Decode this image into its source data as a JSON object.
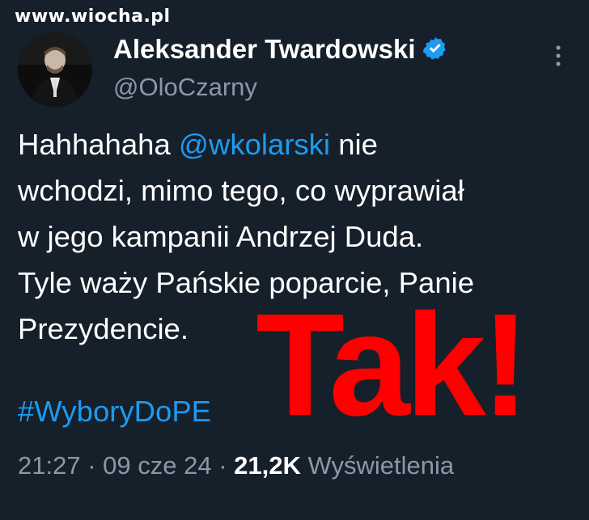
{
  "watermark": "www.wiocha.pl",
  "author": {
    "display_name": "Aleksander Twardowski",
    "handle": "@OloCzarny",
    "verified_icon": "verified-badge-icon"
  },
  "tweet": {
    "text_before_mention": "Hahhahaha ",
    "mention": "@wkolarski",
    "text_after_mention": " nie\nwchodzi, mimo tego, co wyprawiał\nw jego kampanii Andrzej Duda.\nTyle waży Pańskie poparcie, Panie\nPrezydencie.",
    "hashtag": "#WyboryDoPE"
  },
  "meta": {
    "time": "21:27",
    "sep1": " · ",
    "date": "09 cze 24",
    "sep2": " · ",
    "views_count": "21,2K",
    "views_label": " Wyświetlenia"
  },
  "overlay_text": "Tak!",
  "colors": {
    "background": "#15202b",
    "accent": "#1d9bf0",
    "overlay": "#ff0000"
  }
}
